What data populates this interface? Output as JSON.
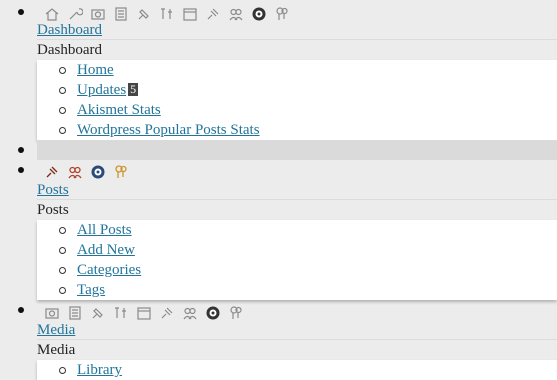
{
  "dashboard": {
    "link_label": "Dashboard",
    "header_label": "Dashboard",
    "items": [
      {
        "label": "Home"
      },
      {
        "label": "Updates",
        "badge": "5"
      },
      {
        "label": "Akismet Stats"
      },
      {
        "label": "Wordpress Popular Posts Stats"
      }
    ]
  },
  "posts": {
    "link_label": "Posts",
    "header_label": "Posts",
    "items": [
      {
        "label": "All Posts"
      },
      {
        "label": "Add New"
      },
      {
        "label": "Categories"
      },
      {
        "label": "Tags"
      }
    ]
  },
  "media": {
    "link_label": "Media",
    "header_label": "Media",
    "items": [
      {
        "label": "Library"
      }
    ]
  },
  "icons": {
    "row1": [
      "home-icon",
      "tools-icon",
      "media-icon",
      "pages-icon",
      "appearance-icon",
      "plugins-icon",
      "calendar-icon",
      "pin-icon",
      "users-icon",
      "comments-icon",
      "settings-icon"
    ],
    "row2": [
      "pin-icon",
      "users-icon",
      "comments-icon",
      "settings-icon"
    ],
    "row3": [
      "media-icon",
      "pages-icon",
      "appearance-icon",
      "plugins-icon",
      "calendar-icon",
      "pin-icon",
      "users-icon",
      "comments-icon",
      "settings-icon"
    ]
  },
  "colors": {
    "link": "#21759b",
    "badge_bg": "#464646"
  }
}
